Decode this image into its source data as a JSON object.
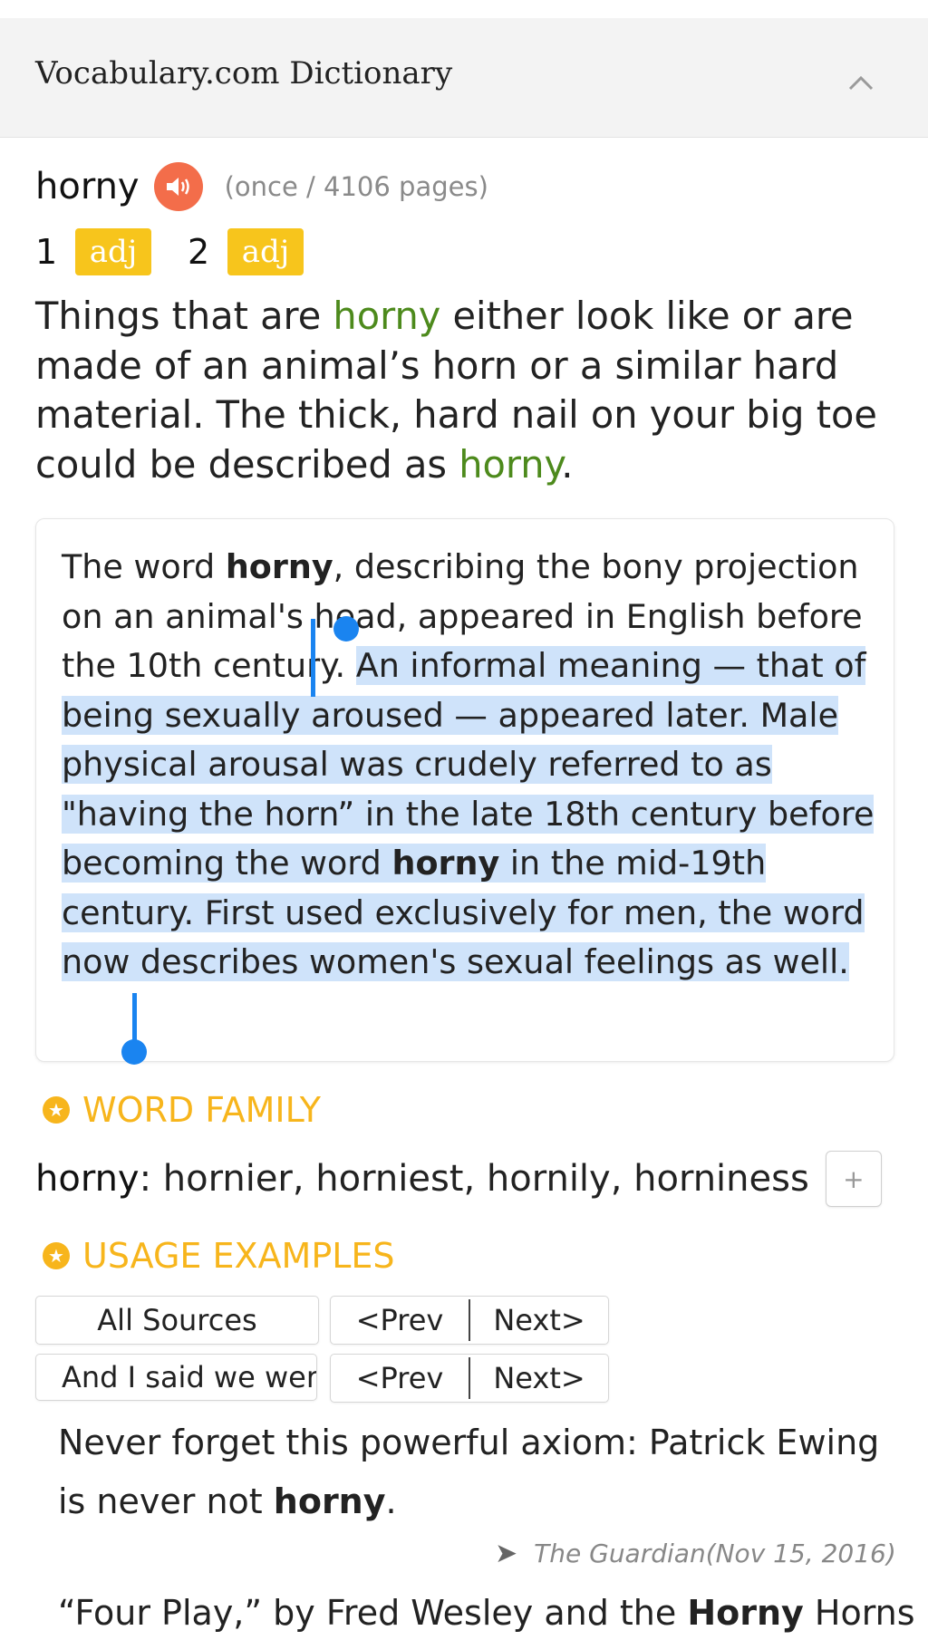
{
  "header": {
    "title": "Vocabulary.com Dictionary"
  },
  "entry": {
    "word": "horny",
    "frequency": "(once / 4106 pages)",
    "senses": [
      {
        "num": "1",
        "pos": "adj"
      },
      {
        "num": "2",
        "pos": "adj"
      }
    ],
    "short_def": {
      "p1": "Things that are ",
      "w1": "horny",
      "p2": " either look like or are made of an animal’s horn or a similar hard material. The thick, hard nail on your big toe could be described as ",
      "w2": "horny",
      "p3": "."
    },
    "long_def": {
      "p1": "The word ",
      "b1": "horny",
      "p2": ", describing the bony projection on an animal's head, appeared in English before the 10th century. ",
      "s1": "An informal meaning — that of being sexually aroused — appeared later. Male physical arousal was crudely referred to as \"having the horn” in the late 18th century before becoming the word ",
      "b2": "horny",
      "s2": " in the mid-19th century. First used exclusively for men, the word now describes women's sexual feelings as well."
    }
  },
  "word_family": {
    "heading": "WORD FAMILY",
    "word": "horny",
    "forms": ": hornier, horniest, hornily, horniness",
    "add_label": "+"
  },
  "usage": {
    "heading": "USAGE EXAMPLES",
    "source_filter": "All Sources",
    "sentence_filter": "And I said we were",
    "prev_label": "<Prev",
    "next_label": "Next>",
    "example1": {
      "p1": "Never forget this powerful axiom: Patrick Ewing is never not ",
      "b1": "horny",
      "p2": ".",
      "source": "The Guardian(Nov 15, 2016)"
    },
    "example2": {
      "p1": "“Four Play,” by Fred Wesley and the ",
      "b1": "Horny",
      "p2": " Horns"
    }
  },
  "colors": {
    "speaker": "#f36d4a",
    "pos_badge": "#f7c51c",
    "section_heading": "#f7b51c",
    "highlight_word": "#4d8a1c",
    "selection": "#cfe3fa",
    "selection_handle": "#1a84f0"
  },
  "icons": {
    "collapse": "chevron-up-icon",
    "audio": "speaker-icon",
    "section": "star-icon",
    "source": "arrow-right-icon"
  }
}
